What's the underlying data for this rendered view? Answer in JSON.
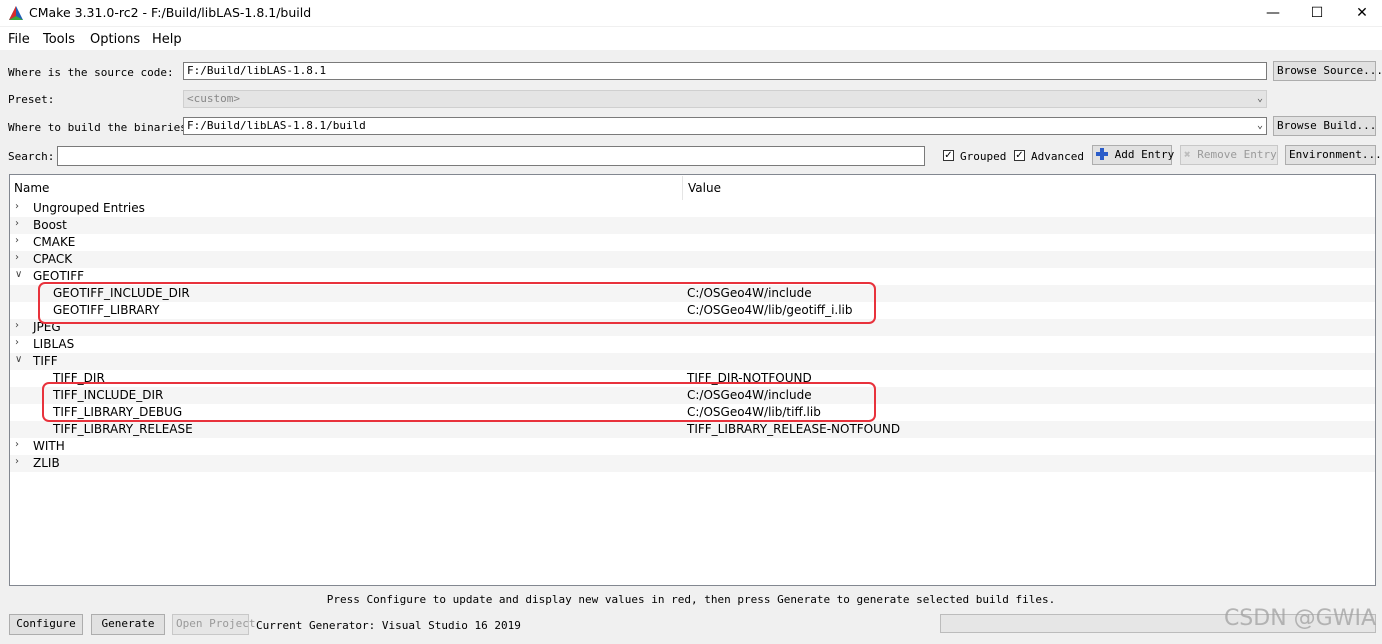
{
  "window": {
    "title": "CMake 3.31.0-rc2 - F:/Build/libLAS-1.8.1/build",
    "minimize_glyph": "—",
    "maximize_glyph": "☐",
    "close_glyph": "✕"
  },
  "menu": [
    "File",
    "Tools",
    "Options",
    "Help"
  ],
  "source": {
    "label": "Where is the source code:",
    "value": "F:/Build/libLAS-1.8.1",
    "browse_label": "Browse Source..."
  },
  "preset": {
    "label": "Preset:",
    "value": "<custom>"
  },
  "binaries": {
    "label": "Where to build the binaries:",
    "value": "F:/Build/libLAS-1.8.1/build",
    "browse_label": "Browse Build..."
  },
  "search": {
    "label": "Search:",
    "value": "",
    "grouped_label": "Grouped",
    "grouped_checked": true,
    "advanced_label": "Advanced",
    "advanced_checked": true,
    "add_entry_label": "Add Entry",
    "remove_entry_label": "Remove Entry",
    "environment_label": "Environment..."
  },
  "tree": {
    "col_name": "Name",
    "col_value": "Value",
    "rows": [
      {
        "name": "Ungrouped Entries",
        "value": "",
        "level": 0,
        "expanded": false
      },
      {
        "name": "Boost",
        "value": "",
        "level": 0,
        "expanded": false
      },
      {
        "name": "CMAKE",
        "value": "",
        "level": 0,
        "expanded": false
      },
      {
        "name": "CPACK",
        "value": "",
        "level": 0,
        "expanded": false
      },
      {
        "name": "GEOTIFF",
        "value": "",
        "level": 0,
        "expanded": true
      },
      {
        "name": "GEOTIFF_INCLUDE_DIR",
        "value": "C:/OSGeo4W/include",
        "level": 1
      },
      {
        "name": "GEOTIFF_LIBRARY",
        "value": "C:/OSGeo4W/lib/geotiff_i.lib",
        "level": 1
      },
      {
        "name": "JPEG",
        "value": "",
        "level": 0,
        "expanded": false
      },
      {
        "name": "LIBLAS",
        "value": "",
        "level": 0,
        "expanded": false
      },
      {
        "name": "TIFF",
        "value": "",
        "level": 0,
        "expanded": true
      },
      {
        "name": "TIFF_DIR",
        "value": "TIFF_DIR-NOTFOUND",
        "level": 1
      },
      {
        "name": "TIFF_INCLUDE_DIR",
        "value": "C:/OSGeo4W/include",
        "level": 1
      },
      {
        "name": "TIFF_LIBRARY_DEBUG",
        "value": "C:/OSGeo4W/lib/tiff.lib",
        "level": 1
      },
      {
        "name": "TIFF_LIBRARY_RELEASE",
        "value": "TIFF_LIBRARY_RELEASE-NOTFOUND",
        "level": 1
      },
      {
        "name": "WITH",
        "value": "",
        "level": 0,
        "expanded": false
      },
      {
        "name": "ZLIB",
        "value": "",
        "level": 0,
        "expanded": false
      }
    ]
  },
  "status": {
    "message": "Press Configure to update and display new values in red, then press Generate to generate selected build files."
  },
  "bottom": {
    "configure_label": "Configure",
    "generate_label": "Generate",
    "open_project_label": "Open Project",
    "generator_text": "Current Generator: Visual Studio 16 2019"
  },
  "watermark": "CSDN @GWIA",
  "colors": {
    "highlight": "#e8323c",
    "add_icon": "#2a5cc9"
  }
}
